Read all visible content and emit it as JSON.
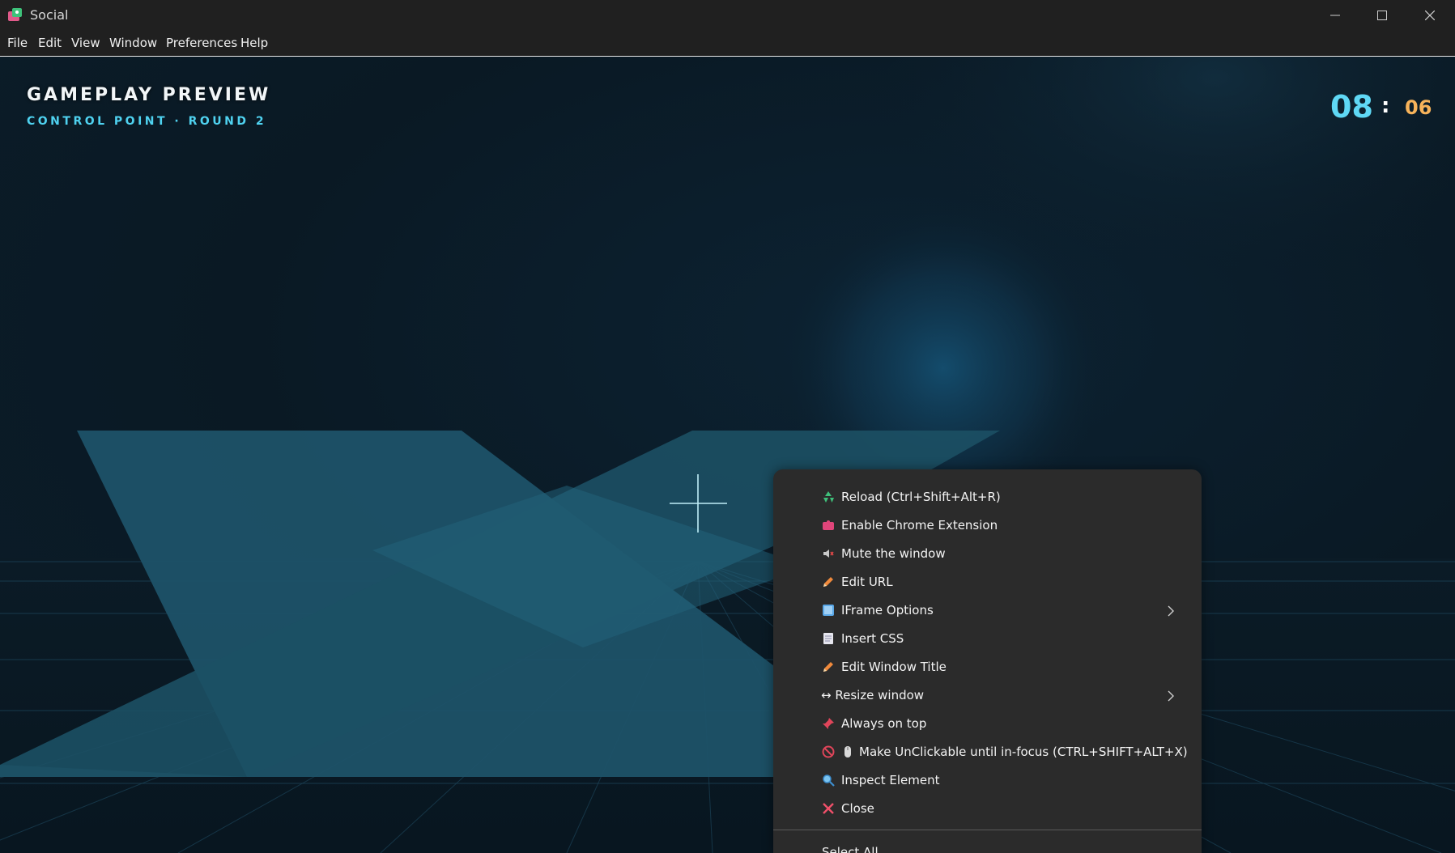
{
  "window": {
    "title": "Social",
    "app_icon": "app-icon",
    "controls": [
      "minimize-icon",
      "maximize-icon",
      "close-icon"
    ]
  },
  "menubar": {
    "items": [
      {
        "label": "File"
      },
      {
        "label": "Edit"
      },
      {
        "label": "View"
      },
      {
        "label": "Window"
      },
      {
        "label": "Preferences"
      },
      {
        "label": "Help"
      }
    ]
  },
  "game": {
    "title": "GAMEPLAY PREVIEW",
    "subtitle": "CONTROL POINT · ROUND 2",
    "timer": {
      "minutes": "08",
      "separator": ":",
      "seconds": "06"
    }
  },
  "context_menu": {
    "items": [
      {
        "icon": "recycle-icon",
        "label": "Reload (Ctrl+Shift+Alt+R)"
      },
      {
        "icon": "puzzle-icon",
        "label": "Enable Chrome Extension"
      },
      {
        "icon": "speaker-muted-icon",
        "label": "Mute the window"
      },
      {
        "icon": "pencil-icon",
        "label": "Edit URL"
      },
      {
        "icon": "frame-icon",
        "label": "IFrame Options",
        "submenu": true
      },
      {
        "icon": "document-icon",
        "label": "Insert CSS"
      },
      {
        "icon": "pencil-icon",
        "label": "Edit Window Title"
      },
      {
        "icon": "resize-arrows-icon",
        "label": "↔ Resize window",
        "submenu": true
      },
      {
        "icon": "pin-icon",
        "label": "Always on top"
      },
      {
        "icon": "no-entry-icon",
        "label": "Make UnClickable until in-focus (CTRL+SHIFT+ALT+X)"
      },
      {
        "icon": "magnifier-icon",
        "label": "Inspect Element"
      },
      {
        "icon": "close-x-icon",
        "label": "Close"
      }
    ],
    "after_separator": {
      "label": "Select All"
    }
  },
  "colors": {
    "titlebar": "#202020",
    "menu_bg": "#2b2b2b",
    "accent_cyan": "#5fd8f5",
    "accent_orange": "#f7b35a"
  }
}
